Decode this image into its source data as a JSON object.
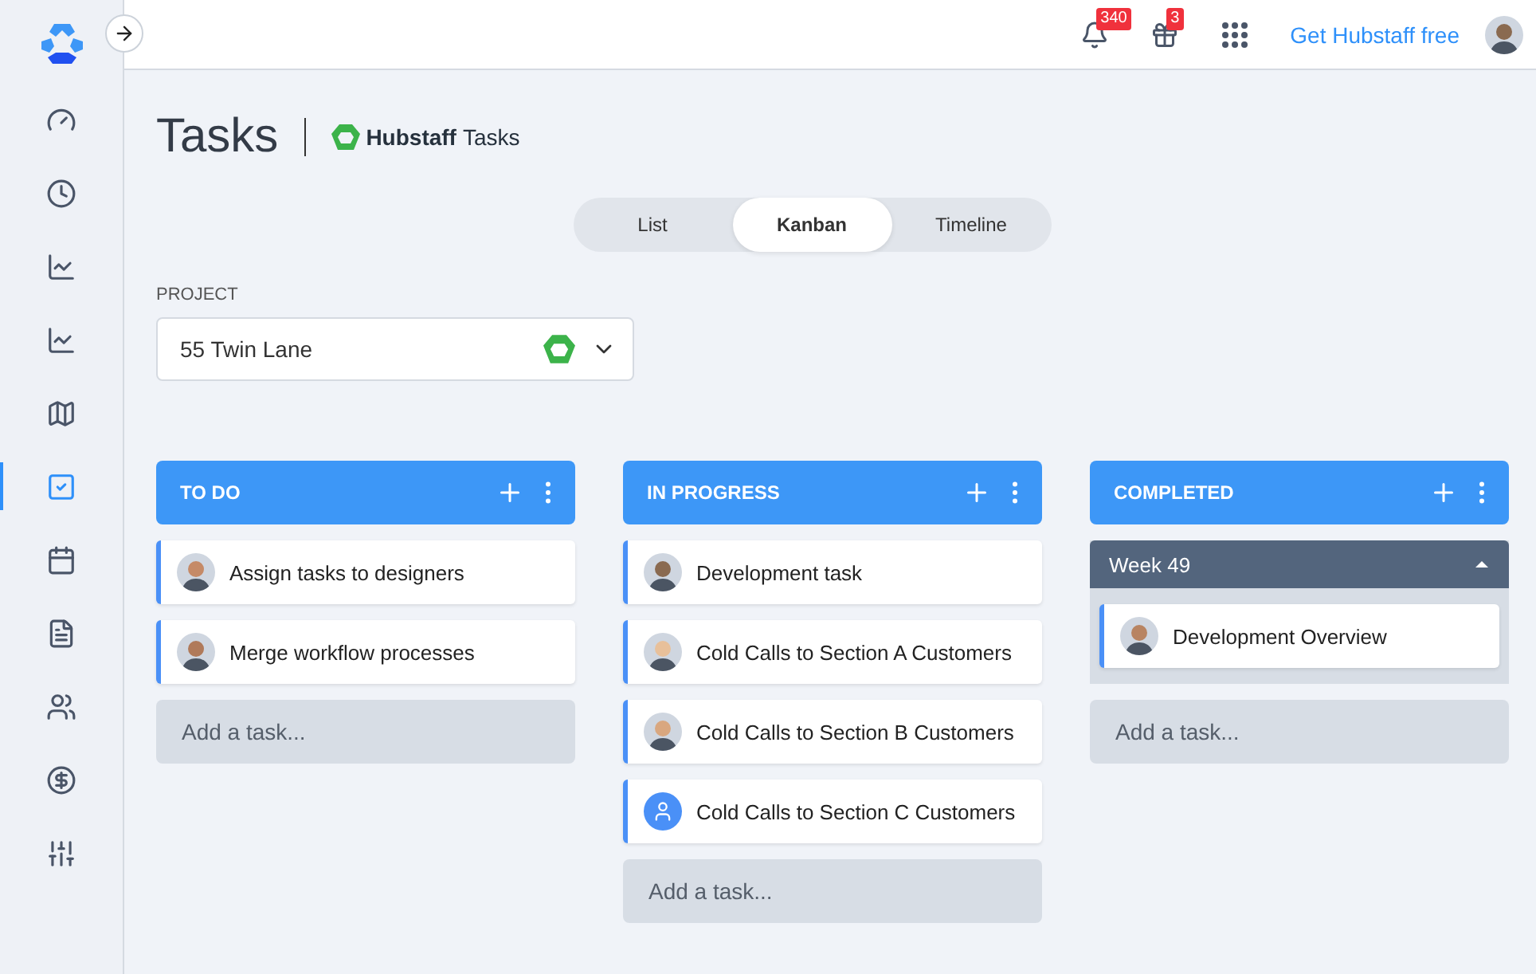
{
  "topbar": {
    "notifications_badge": "340",
    "gifts_badge": "3",
    "cta": "Get Hubstaff free"
  },
  "sidebar": {
    "items": [
      {
        "selected": false
      },
      {
        "selected": false
      },
      {
        "selected": false
      },
      {
        "selected": false
      },
      {
        "selected": false
      },
      {
        "selected": true
      },
      {
        "selected": false
      },
      {
        "selected": false
      },
      {
        "selected": false
      },
      {
        "selected": false
      },
      {
        "selected": false
      }
    ]
  },
  "page": {
    "title": "Tasks",
    "brand": "Hubstaff",
    "brand_suffix": "Tasks"
  },
  "view_tabs": [
    {
      "label": "List",
      "selected": false
    },
    {
      "label": "Kanban",
      "selected": true
    },
    {
      "label": "Timeline",
      "selected": false
    }
  ],
  "project": {
    "label": "PROJECT",
    "value": "55 Twin Lane"
  },
  "columns": [
    {
      "title": "TO DO",
      "tasks": [
        {
          "title": "Assign tasks to designers",
          "kind": "photo"
        },
        {
          "title": "Merge workflow processes",
          "kind": "photo"
        }
      ],
      "add": "Add a task..."
    },
    {
      "title": "IN PROGRESS",
      "tasks": [
        {
          "title": "Development task",
          "kind": "photo"
        },
        {
          "title": "Cold Calls to Section A Customers",
          "kind": "photo"
        },
        {
          "title": "Cold Calls to Section B Customers",
          "kind": "photo"
        },
        {
          "title": "Cold Calls to Section C Customers",
          "kind": "placeholder"
        }
      ],
      "add": "Add a task..."
    },
    {
      "title": "COMPLETED",
      "groups": [
        {
          "title": "Week 49",
          "expanded": true,
          "tasks": [
            {
              "title": "Development Overview",
              "kind": "photo"
            }
          ]
        }
      ],
      "add": "Add a task..."
    }
  ]
}
